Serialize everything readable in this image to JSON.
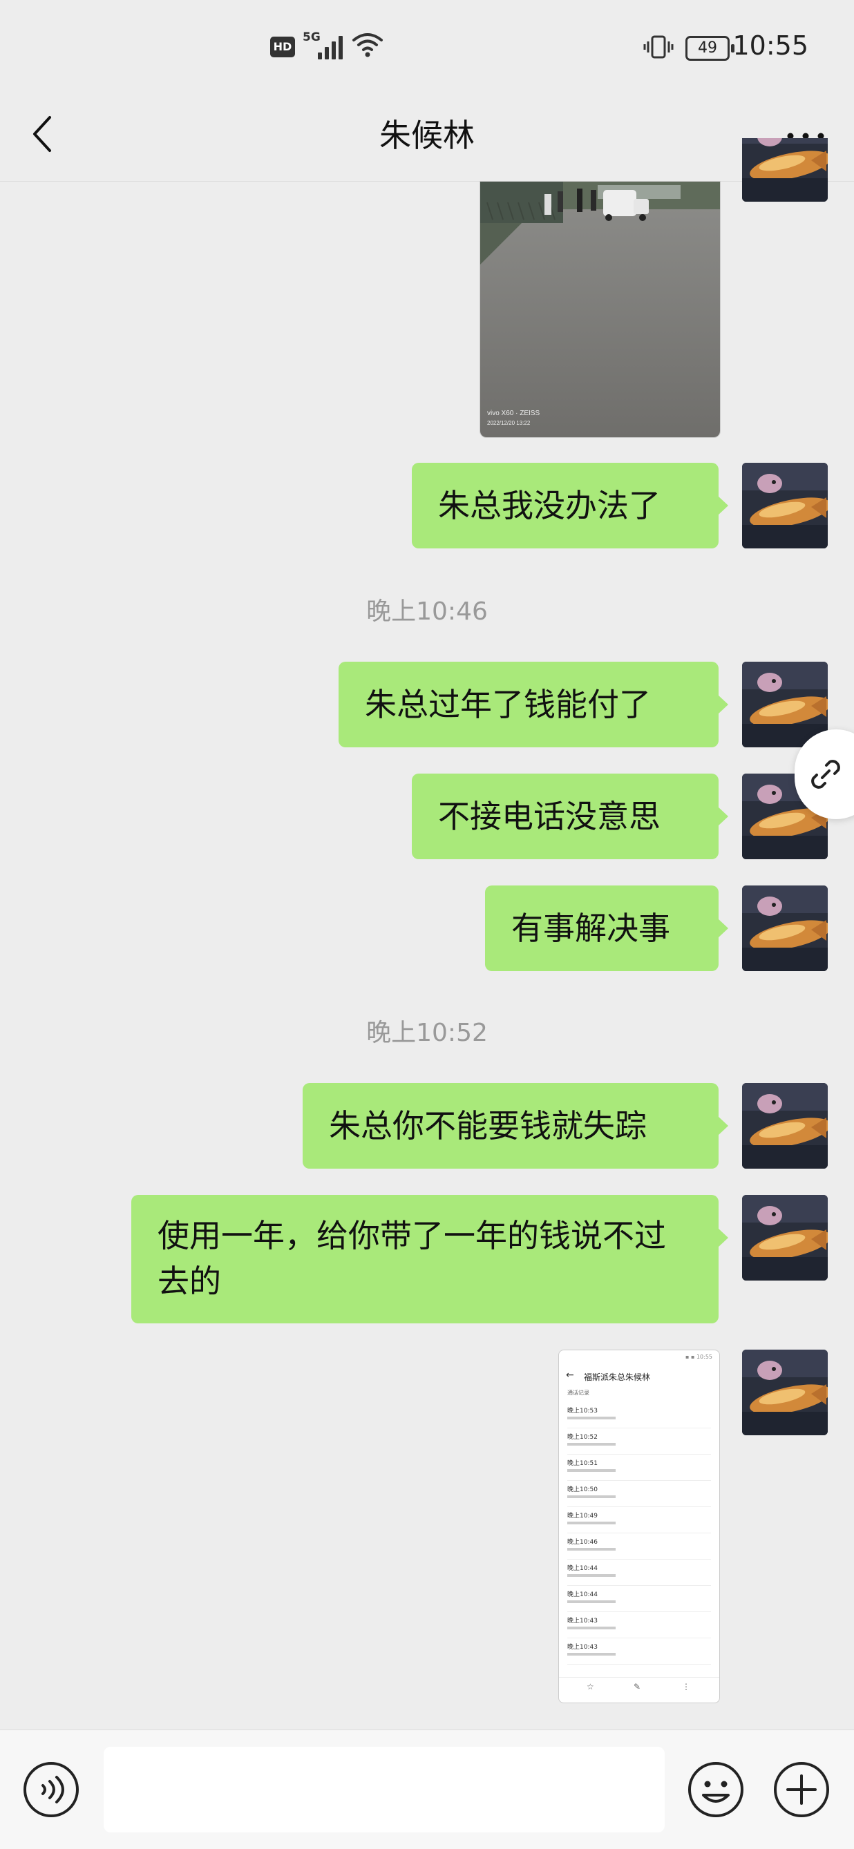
{
  "status_bar": {
    "hd": "HD",
    "network": "5G",
    "battery": "49",
    "time": "10:55"
  },
  "header": {
    "title": "朱候林"
  },
  "messages": {
    "m1": "朱总我没办法了",
    "t1": "晚上10:46",
    "m2": "朱总过年了钱能付了",
    "m3": "不接电话没意思",
    "m4": "有事解决事",
    "t2": "晚上10:52",
    "m5": "朱总你不能要钱就失踪",
    "m6": "使用一年，给你带了一年的钱说不过去的"
  },
  "photo": {
    "watermark_line1": "vivo X60 · ZEISS",
    "watermark_line2": "2022/12/20 13:22"
  },
  "screenshot_thumb": {
    "title": "福斯派朱总朱候林",
    "subtitle": "通话记录",
    "rows": [
      "晚上10:53",
      "晚上10:52",
      "晚上10:51",
      "晚上10:50",
      "晚上10:49",
      "晚上10:46",
      "晚上10:44",
      "晚上10:44",
      "晚上10:43",
      "晚上10:43"
    ]
  },
  "icons": {
    "back": "chevron-left-icon",
    "more": "more-dots-icon",
    "voice": "voice-icon",
    "emoji": "emoji-icon",
    "plus": "plus-icon",
    "link": "link-icon"
  },
  "colors": {
    "bubble": "#a9e97a",
    "background": "#ededed"
  }
}
